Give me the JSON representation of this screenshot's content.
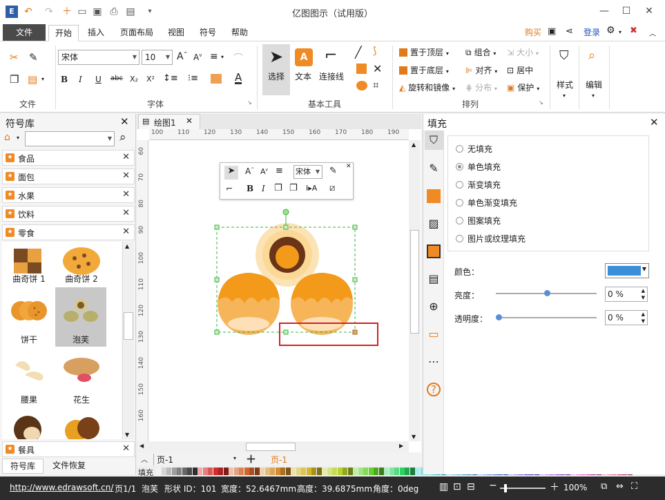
{
  "app": {
    "title": "亿图图示（试用版）"
  },
  "menu": {
    "file": "文件",
    "tabs": [
      "开始",
      "插入",
      "页面布局",
      "视图",
      "符号",
      "帮助"
    ],
    "buy": "购买",
    "login": "登录"
  },
  "ribbon": {
    "font_name": "宋体",
    "font_size": "10",
    "groups": {
      "file": "文件",
      "font": "字体",
      "basic_tools": "基本工具",
      "arrange": "排列"
    },
    "tools": {
      "select": "选择",
      "text": "文本",
      "connector": "连接线"
    },
    "arrange": {
      "bring_front": "置于顶层",
      "send_back": "置于底层",
      "rotate_mirror": "旋转和镜像",
      "group": "组合",
      "align": "对齐",
      "distribute": "分布",
      "size": "大小",
      "center": "居中",
      "protect": "保护"
    },
    "style": "样式",
    "edit": "编辑"
  },
  "library": {
    "title": "符号库",
    "search_placeholder": "",
    "categories": [
      "食品",
      "面包",
      "水果",
      "饮料",
      "零食"
    ],
    "bottom_category": "餐具",
    "symbols": [
      "曲奇饼 1",
      "曲奇饼 2",
      "饼干",
      "泡芙",
      "腰果",
      "花生"
    ],
    "tabs": [
      "符号库",
      "文件恢复"
    ]
  },
  "document": {
    "tab": "绘图1",
    "ruler_top": [
      "100",
      "110",
      "120",
      "130",
      "140",
      "150",
      "160",
      "170",
      "180",
      "190"
    ],
    "ruler_left": [
      "60",
      "70",
      "80",
      "90",
      "100",
      "110",
      "120",
      "130",
      "140",
      "150",
      "160"
    ]
  },
  "floating_toolbar": {
    "font": "宋体"
  },
  "pages": {
    "current": "页-1",
    "tab": "页-1"
  },
  "fill_panel": {
    "title": "填充",
    "options": [
      "无填充",
      "单色填充",
      "渐变填充",
      "单色渐变填充",
      "图案填充",
      "图片或纹理填充"
    ],
    "selected": "单色填充",
    "color_label": "颜色：",
    "color_value": "#3a8fd8",
    "brightness_label": "亮度：",
    "brightness": "0 %",
    "transparency_label": "透明度：",
    "transparency": "0 %"
  },
  "palette_label": "填充",
  "status": {
    "url": "http://www.edrawsoft.cn/",
    "page": "页1/1",
    "shape": "泡芙",
    "shape_id": "形状 ID：101",
    "width": "宽度：52.6467mm",
    "height": "高度：39.6875mm",
    "angle": "角度：0deg",
    "zoom": "100%"
  }
}
